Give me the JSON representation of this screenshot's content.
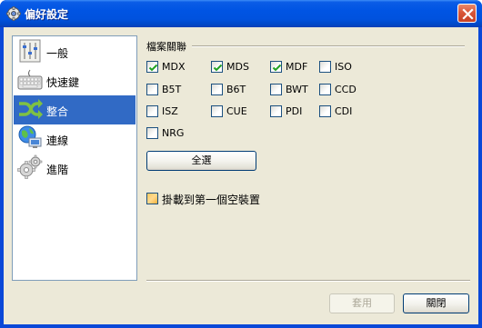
{
  "window": {
    "title": "偏好設定",
    "icon": "gear-icon",
    "close_icon": "close-icon"
  },
  "nav": {
    "selected_index": 2,
    "items": [
      {
        "label": "一般",
        "icon": "sliders-icon"
      },
      {
        "label": "快速鍵",
        "icon": "keyboard-icon"
      },
      {
        "label": "整合",
        "icon": "shuffle-icon"
      },
      {
        "label": "連線",
        "icon": "network-globe-icon"
      },
      {
        "label": "進階",
        "icon": "gears-icon"
      }
    ]
  },
  "file_assoc": {
    "title": "檔案關聯",
    "checkboxes": [
      {
        "label": "MDX",
        "checked": true
      },
      {
        "label": "MDS",
        "checked": true
      },
      {
        "label": "MDF",
        "checked": true
      },
      {
        "label": "ISO",
        "checked": false
      },
      {
        "label": "B5T",
        "checked": false
      },
      {
        "label": "B6T",
        "checked": false
      },
      {
        "label": "BWT",
        "checked": false
      },
      {
        "label": "CCD",
        "checked": false
      },
      {
        "label": "ISZ",
        "checked": false
      },
      {
        "label": "CUE",
        "checked": false
      },
      {
        "label": "PDI",
        "checked": false
      },
      {
        "label": "CDI",
        "checked": false
      },
      {
        "label": "NRG",
        "checked": false
      }
    ],
    "select_all_label": "全選"
  },
  "mount": {
    "label": "掛載到第一個空裝置",
    "checked": false
  },
  "footer": {
    "apply_label": "套用",
    "apply_enabled": false,
    "close_label": "關閉"
  }
}
